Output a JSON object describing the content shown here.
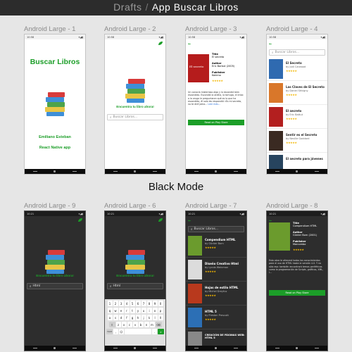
{
  "topbar": {
    "drafts": "Drafts",
    "separator": "/",
    "project": "App Buscar Libros"
  },
  "frames": {
    "f1": "Android Large - 1",
    "f2": "Android Large - 2",
    "f3": "Android Large - 3",
    "f4": "Android Large - 4",
    "f9": "Android Large - 9",
    "f6": "Android Large - 6",
    "f7": "Android Large - 7",
    "f8": "Android Large - 8"
  },
  "section_title": "Black Mode",
  "status": {
    "time_light": "10:58",
    "time_dark": "10:21"
  },
  "splash": {
    "title": "Buscar Libros",
    "author": "Emiliano Esteban",
    "subtitle": "React Native app"
  },
  "home": {
    "tagline": "Encuentra tu libro ahora!",
    "search_placeholder": "Buscar Libros...",
    "search_value": "Html"
  },
  "detail_light": {
    "cover_text": "El secreto",
    "title_key": "Title",
    "title_val": "El secreto",
    "author_key": "Author",
    "author_val": "Eric Barbut (2005)",
    "publisher_key": "Publisher",
    "publisher_val": "Kokimo",
    "description": "Un conocía misterioso algo y lo escondió bien escondido. Escondió la ardilla, la tortuga, el erizo o la oruga le preguntaron qué es lo que ha escondido, él solo les respondió «Es mi secreto, no te diré jama...",
    "read_more": "Leer más...",
    "button": "Read on Play Store"
  },
  "detail_dark": {
    "title_key": "Title",
    "title_val": "Compendium HTML",
    "author_key": "Author",
    "author_val": "Günter Born (2001)",
    "publisher_key": "Publisher",
    "publisher_val": "Marcombo",
    "description": "Esta obra le ofrecerá todos los conocimientos para el uso de HTML hasta la versión 4.0. Y no sólo eso: también encontrará temas periféricos como la programación de Scripts, gráficos, XML, l...",
    "button": "Read on Play Store"
  },
  "results_light": [
    {
      "title": "El Secreto",
      "author": "by Jodi Carwood",
      "color": "#2f6ab0"
    },
    {
      "title": "Las Claves de El Secreto",
      "author": "by Daniel Sévigny",
      "color": "#d9772a"
    },
    {
      "title": "El secreto",
      "author": "by Eric Battut",
      "color": "#b31f1f"
    },
    {
      "title": "Sentir es el Secreto",
      "author": "by Neville Goddard",
      "color": "#3a2a22"
    },
    {
      "title": "El secreto para jóvenes",
      "author": "",
      "color": "#27445e"
    }
  ],
  "results_dark": [
    {
      "title": "Compendium HTML",
      "author": "by Günter Born",
      "color": "#6b9b2d"
    },
    {
      "title": "Diseño Creativo Html",
      "author": "by Lynda Weinman",
      "color": "#dcdcdc"
    },
    {
      "title": "Hojas de estilo HTML",
      "author": "by Michel Dreyfus",
      "color": "#b8391d"
    },
    {
      "title": "HTML 5",
      "author": "by Preston Prescott",
      "color": "#2c6fb5"
    },
    {
      "title": "CREACIÓN DE PÁGINAS WEB: HTML 5",
      "author": "",
      "color": "#888888"
    }
  ],
  "keyboard": {
    "row1": [
      "1",
      "2",
      "3",
      "4",
      "5",
      "6",
      "7",
      "8",
      "9",
      "0"
    ],
    "row2": [
      "q",
      "w",
      "e",
      "r",
      "t",
      "y",
      "u",
      "i",
      "o",
      "p"
    ],
    "row3": [
      "a",
      "s",
      "d",
      "f",
      "g",
      "h",
      "j",
      "k",
      "l",
      "ñ"
    ],
    "row4": [
      "⇧",
      "z",
      "x",
      "c",
      "v",
      "b",
      "n",
      "m",
      "⌫"
    ],
    "row5": [
      "?123",
      ",",
      "☺",
      "",
      "."
    ]
  },
  "icons": {
    "back": "arrow-left-icon",
    "leaf": "leaf-icon",
    "search": "search-icon",
    "star": "star-icon"
  },
  "accent": "#1c9e28",
  "rating": "★★★★★"
}
